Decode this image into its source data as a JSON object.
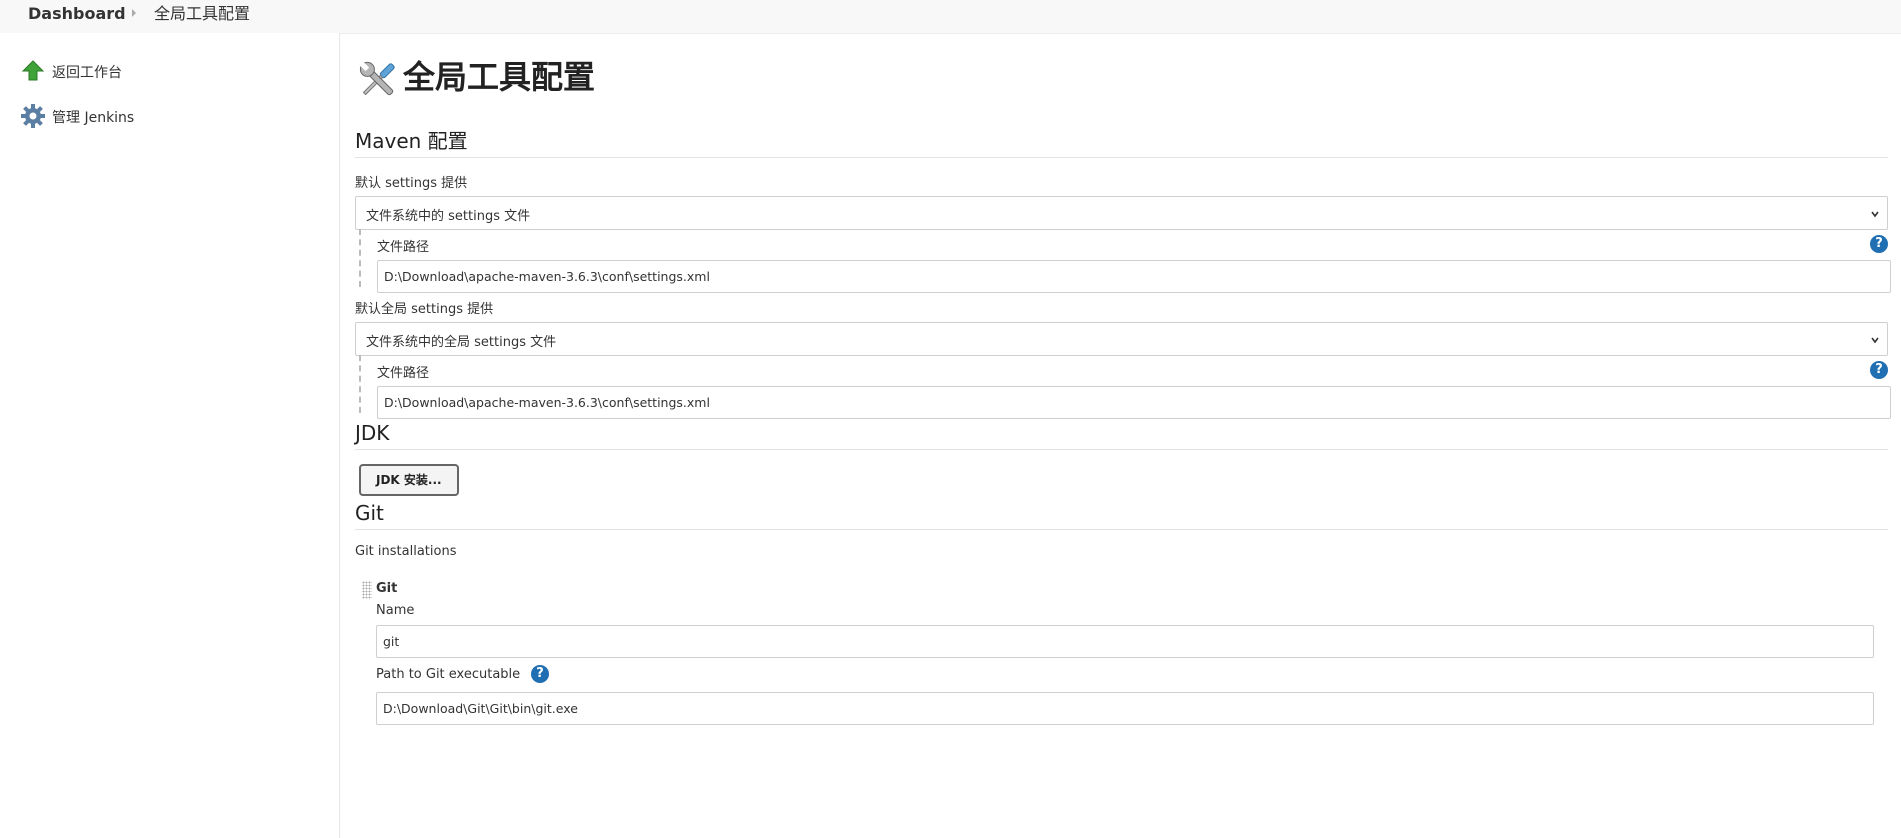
{
  "breadcrumbs": {
    "dashboard": "Dashboard",
    "current": "全局工具配置"
  },
  "sidebar": {
    "items": [
      {
        "label": "返回工作台",
        "icon": "up-arrow-icon"
      },
      {
        "label": "管理 Jenkins",
        "icon": "gear-icon"
      }
    ]
  },
  "page": {
    "title": "全局工具配置",
    "title_icon": "tools-icon"
  },
  "maven": {
    "heading": "Maven 配置",
    "default_settings": {
      "label": "默认 settings 提供",
      "selected": "文件系统中的 settings 文件",
      "path_label": "文件路径",
      "path_value": "D:\\Download\\apache-maven-3.6.3\\conf\\settings.xml"
    },
    "global_settings": {
      "label": "默认全局 settings 提供",
      "selected": "文件系统中的全局 settings 文件",
      "path_label": "文件路径",
      "path_value": "D:\\Download\\apache-maven-3.6.3\\conf\\settings.xml"
    }
  },
  "jdk": {
    "heading": "JDK",
    "button": "JDK 安装..."
  },
  "git": {
    "heading": "Git",
    "installations_label": "Git installations",
    "item_title": "Git",
    "name_label": "Name",
    "name_value": "git",
    "path_label": "Path to Git executable",
    "path_value": "D:\\Download\\Git\\Git\\bin\\git.exe"
  },
  "help_glyph": "?",
  "colors": {
    "help": "#1f6fb2",
    "arrow": "#3fa33a",
    "gear": "#5b7fa3"
  }
}
